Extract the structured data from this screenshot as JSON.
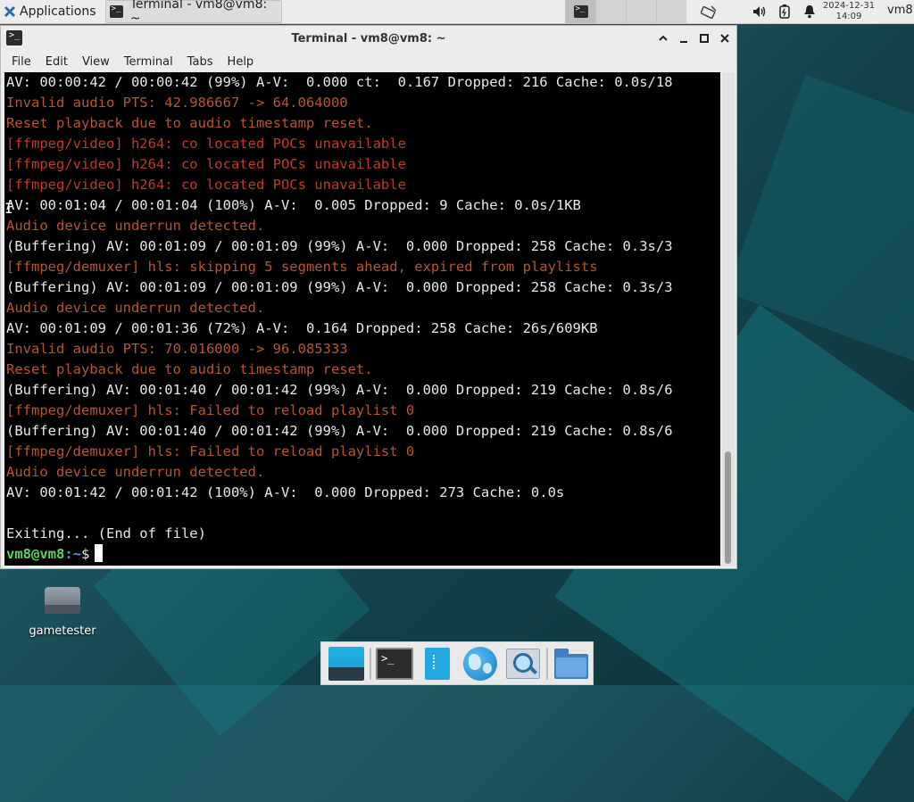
{
  "top_panel": {
    "applications_label": "Applications",
    "task_title": "Terminal - vm8@vm8: ~",
    "clock_date": "2024-12-31",
    "clock_time": "14:09",
    "user_label": "vm8"
  },
  "window": {
    "title": "Terminal - vm8@vm8: ~",
    "menu": [
      "File",
      "Edit",
      "View",
      "Terminal",
      "Tabs",
      "Help"
    ]
  },
  "terminal": {
    "lines": [
      {
        "text": "AV: 00:00:42 / 00:00:42 (99%) A-V:  0.000 ct:  0.167 Dropped: 216 Cache: 0.0s/18",
        "color": "white"
      },
      {
        "text": "Invalid audio PTS: 42.986667 -> 64.064000",
        "color": "orange"
      },
      {
        "text": "Reset playback due to audio timestamp reset.",
        "color": "orange"
      },
      {
        "text": "[ffmpeg/video] h264: co located POCs unavailable",
        "color": "red"
      },
      {
        "text": "[ffmpeg/video] h264: co located POCs unavailable",
        "color": "red"
      },
      {
        "text": "[ffmpeg/video] h264: co located POCs unavailable",
        "color": "red"
      },
      {
        "text": "AV: 00:01:04 / 00:01:04 (100%) A-V:  0.005 Dropped: 9 Cache: 0.0s/1KB",
        "color": "white"
      },
      {
        "text": "Audio device underrun detected.",
        "color": "orange"
      },
      {
        "text": "(Buffering) AV: 00:01:09 / 00:01:09 (99%) A-V:  0.000 Dropped: 258 Cache: 0.3s/3",
        "color": "white"
      },
      {
        "text": "[ffmpeg/demuxer] hls: skipping 5 segments ahead, expired from playlists",
        "color": "orange"
      },
      {
        "text": "(Buffering) AV: 00:01:09 / 00:01:09 (99%) A-V:  0.000 Dropped: 258 Cache: 0.3s/3",
        "color": "white"
      },
      {
        "text": "Audio device underrun detected.",
        "color": "orange"
      },
      {
        "text": "AV: 00:01:09 / 00:01:36 (72%) A-V:  0.164 Dropped: 258 Cache: 26s/609KB",
        "color": "white"
      },
      {
        "text": "Invalid audio PTS: 70.016000 -> 96.085333",
        "color": "orange"
      },
      {
        "text": "Reset playback due to audio timestamp reset.",
        "color": "orange"
      },
      {
        "text": "(Buffering) AV: 00:01:40 / 00:01:42 (99%) A-V:  0.000 Dropped: 219 Cache: 0.8s/6",
        "color": "white"
      },
      {
        "text": "[ffmpeg/demuxer] hls: Failed to reload playlist 0",
        "color": "orange"
      },
      {
        "text": "(Buffering) AV: 00:01:40 / 00:01:42 (99%) A-V:  0.000 Dropped: 219 Cache: 0.8s/6",
        "color": "white"
      },
      {
        "text": "[ffmpeg/demuxer] hls: Failed to reload playlist 0",
        "color": "orange"
      },
      {
        "text": "Audio device underrun detected.",
        "color": "orange"
      },
      {
        "text": "AV: 00:01:42 / 00:01:42 (100%) A-V:  0.000 Dropped: 273 Cache: 0.0s",
        "color": "white"
      },
      {
        "text": "",
        "color": "white"
      },
      {
        "text": "Exiting... (End of file)",
        "color": "white"
      }
    ],
    "prompt_user": "vm8@vm8",
    "prompt_path": ":~",
    "prompt_symbol": "$"
  },
  "desktop": {
    "icon_label": "gametester"
  },
  "colors": {
    "term_white": "#e8e8e8",
    "term_red": "#c0392b",
    "term_orange": "#b5562d",
    "prompt_green": "#5fd35f",
    "prompt_blue": "#5b8ee6"
  },
  "icons": [
    "xfce-logo-icon",
    "terminal-icon",
    "network-icon",
    "volume-icon",
    "battery-icon",
    "bell-icon",
    "drive-icon",
    "show-desktop-icon",
    "files-icon",
    "web-browser-icon",
    "app-finder-icon",
    "folder-icon"
  ]
}
